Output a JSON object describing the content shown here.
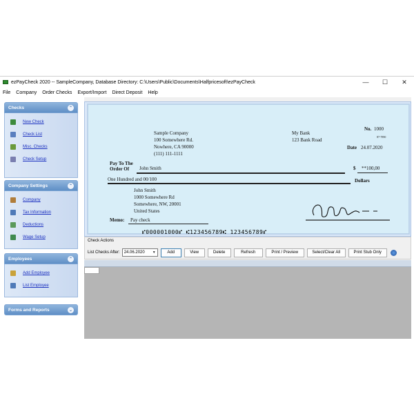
{
  "window": {
    "title": "ezPayCheck 2020 -- SampleCompany, Database Directory: C:\\Users\\Public\\Documents\\Halfpricesoft\\ezPayCheck",
    "controls": {
      "minimize": "—",
      "maximize": "☐",
      "close": "✕"
    }
  },
  "menu": [
    "File",
    "Company",
    "Order Checks",
    "Export/Import",
    "Direct Deposit",
    "Help"
  ],
  "sidebar": {
    "checks": {
      "title": "Checks",
      "items": [
        {
          "label": "New Check",
          "icon": "new-check-icon"
        },
        {
          "label": "Check List",
          "icon": "check-list-icon"
        },
        {
          "label": "Misc. Checks",
          "icon": "misc-checks-icon"
        },
        {
          "label": "Check Setup",
          "icon": "check-setup-icon"
        }
      ]
    },
    "company_settings": {
      "title": "Company Settings",
      "items": [
        {
          "label": "Company",
          "icon": "company-icon"
        },
        {
          "label": "Tax Information",
          "icon": "tax-icon"
        },
        {
          "label": "Deductions",
          "icon": "deductions-icon"
        },
        {
          "label": "Wage Setup",
          "icon": "wage-icon"
        }
      ]
    },
    "employees": {
      "title": "Employees",
      "items": [
        {
          "label": "Add Employee",
          "icon": "add-employee-icon"
        },
        {
          "label": "List Employee",
          "icon": "list-employee-icon"
        }
      ]
    },
    "forms_reports": {
      "title": "Forms and Reports"
    },
    "collapse_symbol": "⌃",
    "expand_symbol": "⌄"
  },
  "check": {
    "company_name": "Sample Company",
    "company_address1": "100 Somewhere Rd.",
    "company_address2": "Nowhere, CA 90000",
    "company_phone": "(111) 111-1111",
    "bank_name": "My Bank",
    "bank_address": "123 Bank Road",
    "number_label": "No.",
    "number": "1000",
    "routing_fraction": "87-7890",
    "date_label": "Date",
    "date": "24.07.2020",
    "pay_to_label_1": "Pay To The",
    "pay_to_label_2": "Order Of",
    "payee": "John Smith",
    "currency_symbol": "$",
    "amount": "**100,00",
    "amount_words": "One Hundred  and 00/100",
    "dollars_label": "Dollars",
    "payee_name": "John Smith",
    "payee_address1": "1000 Somewhere Rd",
    "payee_address2": "Somewhere, NW, 20001",
    "payee_country": "United States",
    "memo_label": "Memo:",
    "memo": "Pay check",
    "micr": "⑈000001000⑈ ⑆123456789⑆ 123456789⑈"
  },
  "actions": {
    "legend": "Check Actions",
    "list_after_label": "List Checks After:",
    "list_after_date": "24.06.2020",
    "buttons": [
      "Add",
      "View",
      "Delete",
      "Refresh",
      "Print / Preview",
      "Select/Clear All",
      "Print Stub Only"
    ]
  },
  "colors": {
    "accent": "#5f8fc6",
    "link": "#1a2fbf",
    "check_background": "#d8eef8"
  }
}
